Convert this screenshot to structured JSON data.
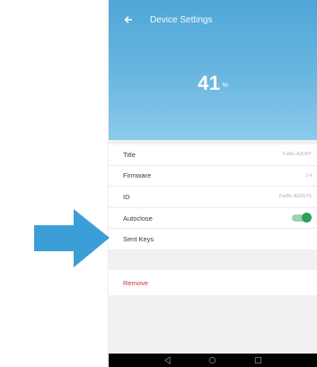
{
  "app": {
    "title": "Device Settings",
    "value": "41",
    "unit": "%"
  },
  "rows": [
    {
      "label": "Title",
      "value": "Farbic A2D0/T"
    },
    {
      "label": "Firmware",
      "value": "3.4"
    },
    {
      "label": "ID",
      "value": "FarBic A2D0/TS"
    },
    {
      "label": "Autoclose",
      "toggle": true
    },
    {
      "label": "Sent Keys"
    }
  ],
  "actions": {
    "remove": "Remove"
  },
  "colors": {
    "header": "#5aaedc",
    "toggle": "#2f9e5d",
    "remove": "#d0342c",
    "arrow": "#3c9ed7"
  }
}
